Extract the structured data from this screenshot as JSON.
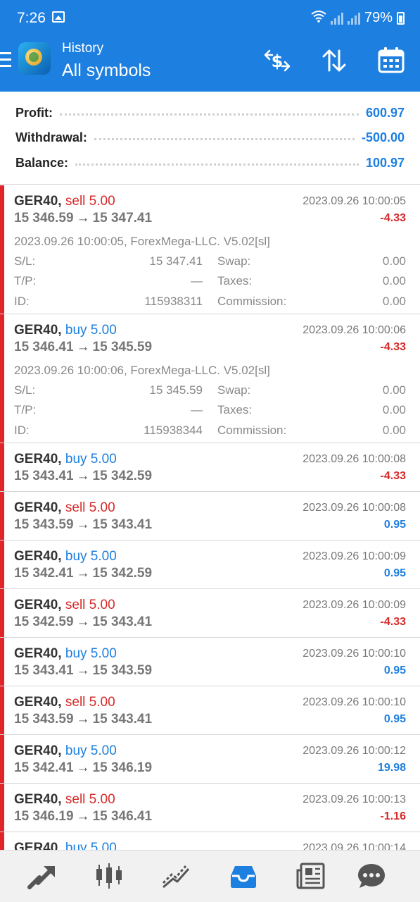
{
  "status": {
    "time": "7:26",
    "battery": "79%"
  },
  "appbar": {
    "subtitle": "History",
    "title": "All symbols"
  },
  "icons": {
    "menu": "menu-icon",
    "logo": "app-logo-icon",
    "filter_dollar": "dollar-filter-icon",
    "sort": "sort-icon",
    "calendar": "calendar-icon",
    "nav": [
      "trade-icon",
      "chart-candles-icon",
      "trend-icon",
      "history-inbox-icon",
      "news-icon",
      "chat-icon"
    ]
  },
  "colors": {
    "accent": "#1d7fe0",
    "negative": "#d62a2a",
    "sidebar_marker": "#e0242a"
  },
  "summary": {
    "profit_label": "Profit:",
    "profit_value": "600.97",
    "withdrawal_label": "Withdrawal:",
    "withdrawal_value": "-500.00",
    "balance_label": "Balance:",
    "balance_value": "100.97"
  },
  "labels": {
    "sl": "S/L:",
    "tp": "T/P:",
    "id": "ID:",
    "swap": "Swap:",
    "taxes": "Taxes:",
    "commission": "Commission:",
    "arrow": "→"
  },
  "deals": [
    {
      "symbol": "GER40,",
      "side": "sell 5.00",
      "open": "15 346.59",
      "close": "15 347.41",
      "time": "2023.09.26 10:00:05",
      "profit": "-4.33",
      "comment": "2023.09.26 10:00:05, ForexMega-LLC. V5.02[sl]",
      "sl": "15 347.41",
      "tp": "—",
      "id": "115938311",
      "swap": "0.00",
      "taxes": "0.00",
      "commission": "0.00"
    },
    {
      "symbol": "GER40,",
      "side": "buy 5.00",
      "open": "15 346.41",
      "close": "15 345.59",
      "time": "2023.09.26 10:00:06",
      "profit": "-4.33",
      "comment": "2023.09.26 10:00:06, ForexMega-LLC. V5.02[sl]",
      "sl": "15 345.59",
      "tp": "—",
      "id": "115938344",
      "swap": "0.00",
      "taxes": "0.00",
      "commission": "0.00"
    },
    {
      "symbol": "GER40,",
      "side": "buy 5.00",
      "open": "15 343.41",
      "close": "15 342.59",
      "time": "2023.09.26 10:00:08",
      "profit": "-4.33"
    },
    {
      "symbol": "GER40,",
      "side": "sell 5.00",
      "open": "15 343.59",
      "close": "15 343.41",
      "time": "2023.09.26 10:00:08",
      "profit": "0.95"
    },
    {
      "symbol": "GER40,",
      "side": "buy 5.00",
      "open": "15 342.41",
      "close": "15 342.59",
      "time": "2023.09.26 10:00:09",
      "profit": "0.95"
    },
    {
      "symbol": "GER40,",
      "side": "sell 5.00",
      "open": "15 342.59",
      "close": "15 343.41",
      "time": "2023.09.26 10:00:09",
      "profit": "-4.33"
    },
    {
      "symbol": "GER40,",
      "side": "buy 5.00",
      "open": "15 343.41",
      "close": "15 343.59",
      "time": "2023.09.26 10:00:10",
      "profit": "0.95"
    },
    {
      "symbol": "GER40,",
      "side": "sell 5.00",
      "open": "15 343.59",
      "close": "15 343.41",
      "time": "2023.09.26 10:00:10",
      "profit": "0.95"
    },
    {
      "symbol": "GER40,",
      "side": "buy 5.00",
      "open": "15 342.41",
      "close": "15 346.19",
      "time": "2023.09.26 10:00:12",
      "profit": "19.98"
    },
    {
      "symbol": "GER40,",
      "side": "sell 5.00",
      "open": "15 346.19",
      "close": "15 346.41",
      "time": "2023.09.26 10:00:13",
      "profit": "-1.16"
    },
    {
      "symbol": "GER40,",
      "side": "buy 5.00",
      "open": "",
      "close": "",
      "time": "2023.09.26 10:00:14",
      "profit": ""
    }
  ]
}
